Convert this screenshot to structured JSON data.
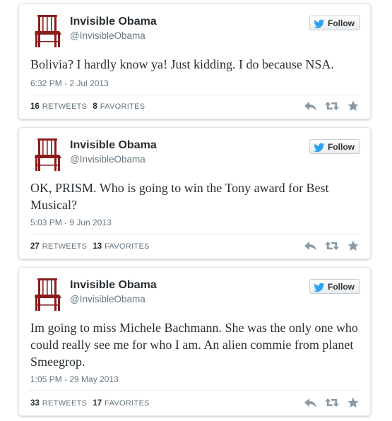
{
  "colors": {
    "chair": "#8b1c1c",
    "twitter_bird": "#2aa3ef",
    "action_icon": "#8899a6"
  },
  "icons": {
    "avatar": "red-chair-avatar",
    "follow": "twitter-bird-icon",
    "reply": "reply-icon",
    "retweet": "retweet-icon",
    "favorite": "star-icon"
  },
  "tweets": [
    {
      "name": "Invisible Obama",
      "handle": "@InvisibleObama",
      "follow_label": "Follow",
      "text": "Bolivia? I hardly know ya! Just kidding. I do because NSA.",
      "timestamp": "6:32 PM - 2 Jul 2013",
      "retweets_count": "16",
      "retweets_label": "RETWEETS",
      "favorites_count": "8",
      "favorites_label": "FAVORITES"
    },
    {
      "name": "Invisible Obama",
      "handle": "@InvisibleObama",
      "follow_label": "Follow",
      "text": "OK, PRISM. Who is going to win the Tony award for Best Musical?",
      "timestamp": "5:03 PM - 9 Jun 2013",
      "retweets_count": "27",
      "retweets_label": "RETWEETS",
      "favorites_count": "13",
      "favorites_label": "FAVORITES"
    },
    {
      "name": "Invisible Obama",
      "handle": "@InvisibleObama",
      "follow_label": "Follow",
      "text": "Im going to miss Michele Bachmann. She was the only one who could really see me for who I am. An alien commie from planet Smeegrop.",
      "timestamp": "1:05 PM - 29 May 2013",
      "retweets_count": "33",
      "retweets_label": "RETWEETS",
      "favorites_count": "17",
      "favorites_label": "FAVORITES"
    }
  ]
}
